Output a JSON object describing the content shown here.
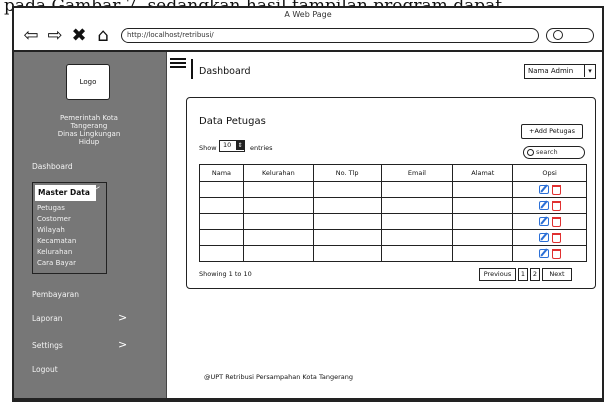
{
  "caption": "pada Gambar 7, sedangkan hasil tampilan program dapat",
  "browser": {
    "window_title": "A Web Page",
    "url": "http://localhost/retribusi/",
    "nav_icons": [
      "back-arrow-icon",
      "forward-arrow-icon",
      "close-icon",
      "home-icon"
    ]
  },
  "sidebar": {
    "logo": "Logo",
    "org_line1": "Pemerintah Kota",
    "org_line2": "Tangerang",
    "org_line3": "Dinas Lingkungan",
    "org_line4": "Hidup",
    "dashboard": "Dashboard",
    "master_data": "Master Data",
    "master_items": [
      "Petugas",
      "Costomer",
      "Wilayah",
      "Kecamatan",
      "Kelurahan",
      "Cara Bayar"
    ],
    "pembayaran": "Pembayaran",
    "laporan": "Laporan",
    "settings": "Settings",
    "logout": "Logout"
  },
  "header": {
    "page_title": "Dashboard",
    "admin_select": "Nama Admin"
  },
  "card": {
    "title": "Data Petugas",
    "add_button": "+Add Petugas",
    "show_label": "Show",
    "show_value": "10",
    "entries_label": "entries",
    "search_placeholder": "search",
    "columns": [
      "Nama",
      "Kelurahan",
      "No. Tlp",
      "Email",
      "Alamat",
      "Opsi"
    ],
    "showing": "Showing 1 to 10",
    "pager": {
      "previous": "Previous",
      "p1": "1",
      "p2": "2",
      "next": "Next"
    }
  },
  "footer": "@UPT Retribusi Persampahan Kota Tangerang",
  "colors": {
    "sidebar": "#777777",
    "edit_icon": "#2b6fd6",
    "delete_icon": "#e03030"
  }
}
